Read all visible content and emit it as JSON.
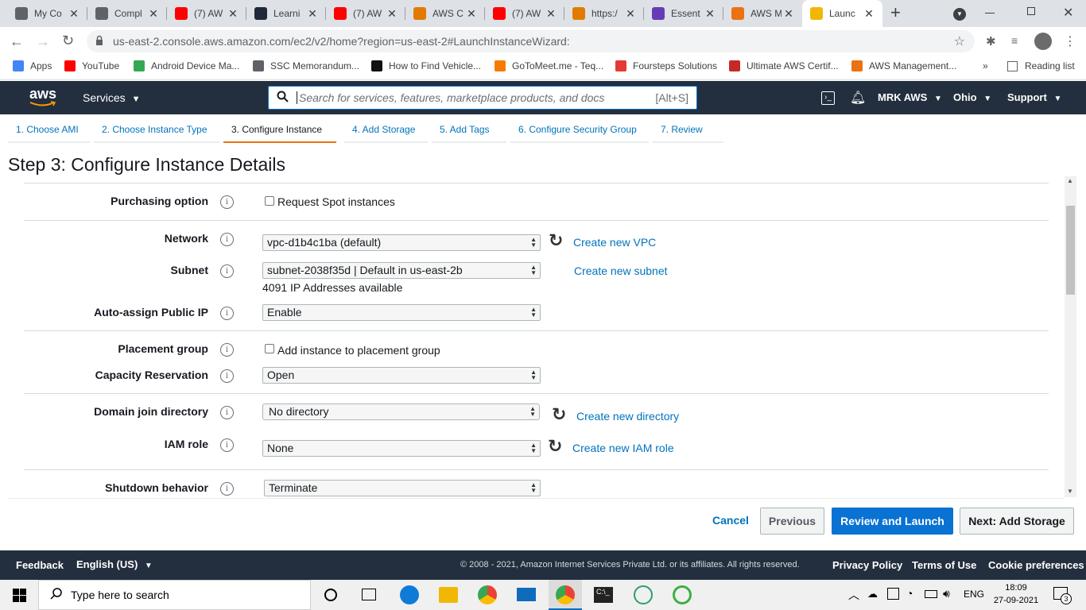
{
  "browser": {
    "tabs": [
      {
        "title": "My Co",
        "icon": "gear-icon",
        "color": "#5f6368"
      },
      {
        "title": "Compl",
        "icon": "gear-icon",
        "color": "#5f6368"
      },
      {
        "title": "(7) AW",
        "icon": "youtube-icon",
        "color": "#ff0000"
      },
      {
        "title": "Learni",
        "icon": "learning-icon",
        "color": "#1f2937"
      },
      {
        "title": "(7) AW",
        "icon": "youtube-icon",
        "color": "#ff0000"
      },
      {
        "title": "AWS C",
        "icon": "aws-bug-icon",
        "color": "#e07b00"
      },
      {
        "title": "(7) AW",
        "icon": "youtube-icon",
        "color": "#ff0000"
      },
      {
        "title": "https:/",
        "icon": "aws-bug-icon",
        "color": "#e07b00"
      },
      {
        "title": "Essent",
        "icon": "doc-icon",
        "color": "#673ab7"
      },
      {
        "title": "AWS M",
        "icon": "aws-cube-icon",
        "color": "#ec7211"
      },
      {
        "title": "Launc",
        "icon": "aws-box-icon",
        "color": "#f2b705"
      }
    ],
    "url": "us-east-2.console.aws.amazon.com/ec2/v2/home?region=us-east-2#LaunchInstanceWizard:",
    "bookmarks": [
      {
        "label": "Apps",
        "color": "#4285f4"
      },
      {
        "label": "YouTube",
        "color": "#ff0000"
      },
      {
        "label": "Android Device Ma...",
        "color": "#34a853"
      },
      {
        "label": "SSC Memorandum...",
        "color": "#5f6368"
      },
      {
        "label": "How to Find Vehicle...",
        "color": "#111111"
      },
      {
        "label": "GoToMeet.me - Teq...",
        "color": "#f57c00"
      },
      {
        "label": "Foursteps Solutions",
        "color": "#e53935"
      },
      {
        "label": "Ultimate AWS Certif...",
        "color": "#c62828"
      },
      {
        "label": "AWS Management...",
        "color": "#ec7211"
      }
    ],
    "reading_list": "Reading list",
    "more": "»"
  },
  "aws": {
    "logo": "aws",
    "services": "Services",
    "search_placeholder": "Search for services, features, marketplace products, and docs",
    "search_shortcut": "[Alt+S]",
    "account": "MRK AWS",
    "region": "Ohio",
    "support": "Support"
  },
  "wizard": {
    "steps": [
      "1. Choose AMI",
      "2. Choose Instance Type",
      "3. Configure Instance",
      "4. Add Storage",
      "5. Add Tags",
      "6. Configure Security Group",
      "7. Review"
    ],
    "active_step": 2,
    "title": "Step 3: Configure Instance Details"
  },
  "form": {
    "purchasing_option": {
      "label": "Purchasing option",
      "checkbox": "Request Spot instances"
    },
    "network": {
      "label": "Network",
      "value": "vpc-d1b4c1ba (default)",
      "link": "Create new VPC"
    },
    "subnet": {
      "label": "Subnet",
      "value": "subnet-2038f35d | Default in us-east-2b",
      "link": "Create new subnet",
      "note": "4091 IP Addresses available"
    },
    "auto_ip": {
      "label": "Auto-assign Public IP",
      "value": "Enable"
    },
    "placement": {
      "label": "Placement group",
      "checkbox": "Add instance to placement group"
    },
    "capacity": {
      "label": "Capacity Reservation",
      "value": "Open"
    },
    "domain": {
      "label": "Domain join directory",
      "value": "No directory",
      "link": "Create new directory"
    },
    "iam": {
      "label": "IAM role",
      "value": "None",
      "link": "Create new IAM role"
    },
    "shutdown": {
      "label": "Shutdown behavior",
      "value": "Terminate"
    }
  },
  "actions": {
    "cancel": "Cancel",
    "previous": "Previous",
    "review": "Review and Launch",
    "next": "Next: Add Storage"
  },
  "footer": {
    "feedback": "Feedback",
    "language": "English (US)",
    "copyright": "© 2008 - 2021, Amazon Internet Services Private Ltd. or its affiliates. All rights reserved.",
    "privacy": "Privacy Policy",
    "terms": "Terms of Use",
    "cookies": "Cookie preferences"
  },
  "taskbar": {
    "search": "Type here to search",
    "lang": "ENG",
    "time": "18:09",
    "date": "27-09-2021",
    "notifications": "3"
  },
  "colors": {
    "aws_nav": "#232f3e",
    "accent": "#ec7211",
    "link": "#0073bb",
    "primary_button": "#0972d3"
  }
}
